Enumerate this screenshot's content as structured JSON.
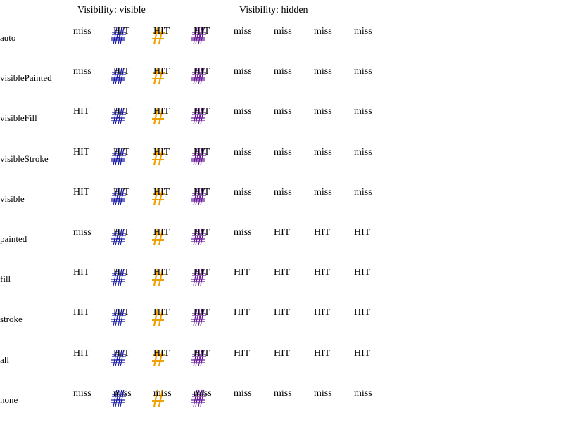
{
  "headers": {
    "visible": "Visibility: visible",
    "hidden": "Visibility: hidden"
  },
  "colors": {
    "text": "#000000",
    "blue_glyph": "#1a1aa8",
    "blue_glyph_fill": "#ffffff",
    "orange_glyph": "#f0a000",
    "purple_glyph": "#6a1a9a",
    "purple_glyph_fill": "#ffffff"
  },
  "column_glyphs": [
    "none",
    "hash-blue",
    "hash-orange",
    "hash-purple",
    "none",
    "none",
    "none",
    "none"
  ],
  "rows": [
    {
      "label": "auto",
      "cells": [
        "miss",
        "HIT",
        "HIT",
        "HIT",
        "miss",
        "miss",
        "miss",
        "miss"
      ]
    },
    {
      "label": "visiblePainted",
      "cells": [
        "miss",
        "HIT",
        "HIT",
        "HIT",
        "miss",
        "miss",
        "miss",
        "miss"
      ]
    },
    {
      "label": "visibleFill",
      "cells": [
        "HIT",
        "HIT",
        "HIT",
        "HIT",
        "miss",
        "miss",
        "miss",
        "miss"
      ]
    },
    {
      "label": "visibleStroke",
      "cells": [
        "HIT",
        "HIT",
        "HIT",
        "HIT",
        "miss",
        "miss",
        "miss",
        "miss"
      ]
    },
    {
      "label": "visible",
      "cells": [
        "HIT",
        "HIT",
        "HIT",
        "HIT",
        "miss",
        "miss",
        "miss",
        "miss"
      ]
    },
    {
      "label": "painted",
      "cells": [
        "miss",
        "HIT",
        "HIT",
        "HIT",
        "miss",
        "HIT",
        "HIT",
        "HIT"
      ]
    },
    {
      "label": "fill",
      "cells": [
        "HIT",
        "HIT",
        "HIT",
        "HIT",
        "HIT",
        "HIT",
        "HIT",
        "HIT"
      ]
    },
    {
      "label": "stroke",
      "cells": [
        "HIT",
        "HIT",
        "HIT",
        "HIT",
        "HIT",
        "HIT",
        "HIT",
        "HIT"
      ]
    },
    {
      "label": "all",
      "cells": [
        "HIT",
        "HIT",
        "HIT",
        "HIT",
        "HIT",
        "HIT",
        "HIT",
        "HIT"
      ]
    },
    {
      "label": "none",
      "cells": [
        "miss",
        "miss",
        "miss",
        "miss",
        "miss",
        "miss",
        "miss",
        "miss"
      ]
    }
  ]
}
